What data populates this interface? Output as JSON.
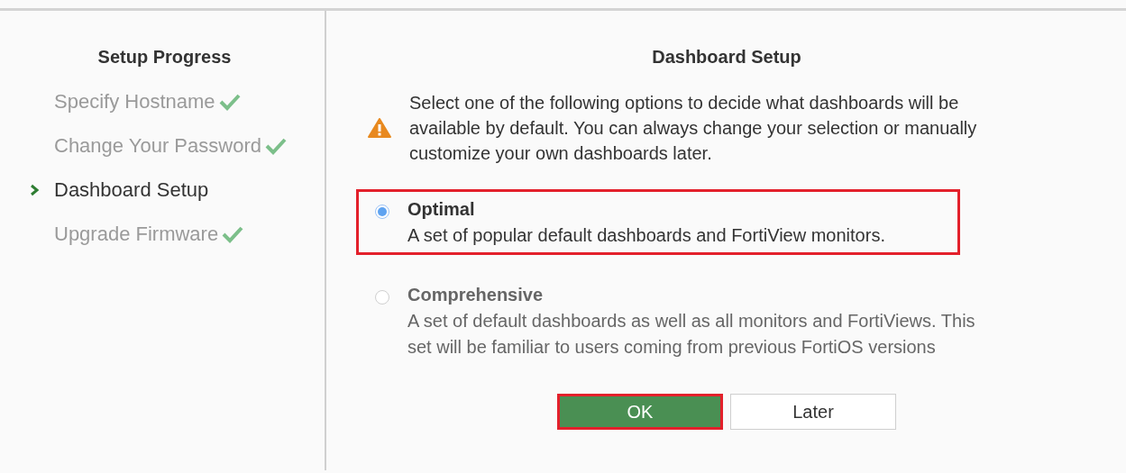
{
  "sidebar": {
    "title": "Setup Progress",
    "steps": [
      {
        "label": "Specify Hostname",
        "done": true,
        "selected": false
      },
      {
        "label": "Change Your Password",
        "done": true,
        "selected": false
      },
      {
        "label": "Dashboard Setup",
        "done": false,
        "selected": true
      },
      {
        "label": "Upgrade Firmware",
        "done": true,
        "selected": false
      }
    ]
  },
  "main": {
    "title": "Dashboard Setup",
    "notice": "Select one of the following options to decide what dashboards will be available by default. You can always change your selection or manually customize your own dashboards later.",
    "options": [
      {
        "label": "Optimal",
        "description": "A set of popular default dashboards and FortiView monitors.",
        "selected": true,
        "highlighted": true
      },
      {
        "label": "Comprehensive",
        "description": "A set of default dashboards as well as all monitors and FortiViews. This set will be familiar to users coming from previous FortiOS versions",
        "selected": false,
        "highlighted": false
      }
    ],
    "buttons": [
      {
        "label": "OK",
        "kind": "primary",
        "highlighted": true
      },
      {
        "label": "Later",
        "kind": "secondary",
        "highlighted": false
      }
    ]
  }
}
